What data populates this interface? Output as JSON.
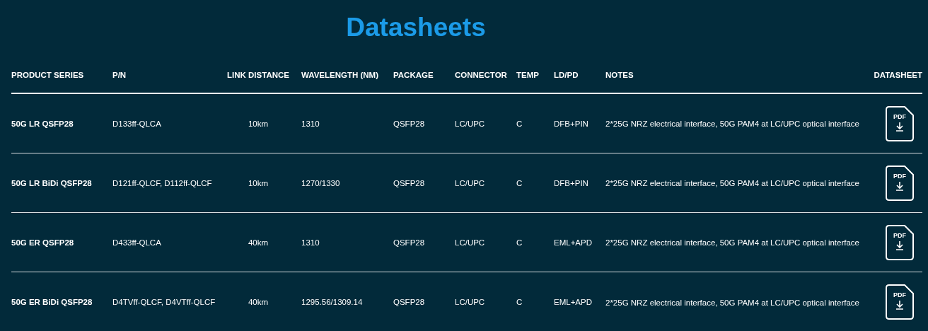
{
  "title": "Datasheets",
  "table": {
    "columns": [
      "PRODUCT SERIES",
      "P/N",
      "LINK DISTANCE",
      "WAVELENGTH (NM)",
      "PACKAGE",
      "CONNECTOR",
      "TEMP",
      "LD/PD",
      "NOTES",
      "DATASHEET"
    ],
    "rows": [
      {
        "product_series": "50G LR QSFP28",
        "pn": "D133ff-QLCA",
        "link_distance": "10km",
        "wavelength": "1310",
        "package": "QSFP28",
        "connector": "LC/UPC",
        "temp": "C",
        "ld_pd": "DFB+PIN",
        "notes": "2*25G NRZ electrical interface, 50G PAM4 at LC/UPC optical interface",
        "datasheet": "PDF"
      },
      {
        "product_series": "50G LR BiDi QSFP28",
        "pn": "D121ff-QLCF, D112ff-QLCF",
        "link_distance": "10km",
        "wavelength": "1270/1330",
        "package": "QSFP28",
        "connector": "LC/UPC",
        "temp": "C",
        "ld_pd": "DFB+PIN",
        "notes": "2*25G NRZ electrical interface, 50G PAM4 at LC/UPC optical interface",
        "datasheet": "PDF"
      },
      {
        "product_series": "50G ER QSFP28",
        "pn": "D433ff-QLCA",
        "link_distance": "40km",
        "wavelength": "1310",
        "package": "QSFP28",
        "connector": "LC/UPC",
        "temp": "C",
        "ld_pd": "EML+APD",
        "notes": "2*25G NRZ electrical interface, 50G PAM4 at LC/UPC optical interface",
        "datasheet": "PDF"
      },
      {
        "product_series": "50G ER BiDi QSFP28",
        "pn": "D4TVff-QLCF, D4VTff-QLCF",
        "link_distance": "40km",
        "wavelength": "1295.56/1309.14",
        "package": "QSFP28",
        "connector": "LC/UPC",
        "temp": "C",
        "ld_pd": "EML+APD",
        "notes": "2*25G NRZ electrical interface, 50G PAM4 at LC/UPC optical interface",
        "datasheet": "PDF"
      }
    ]
  }
}
